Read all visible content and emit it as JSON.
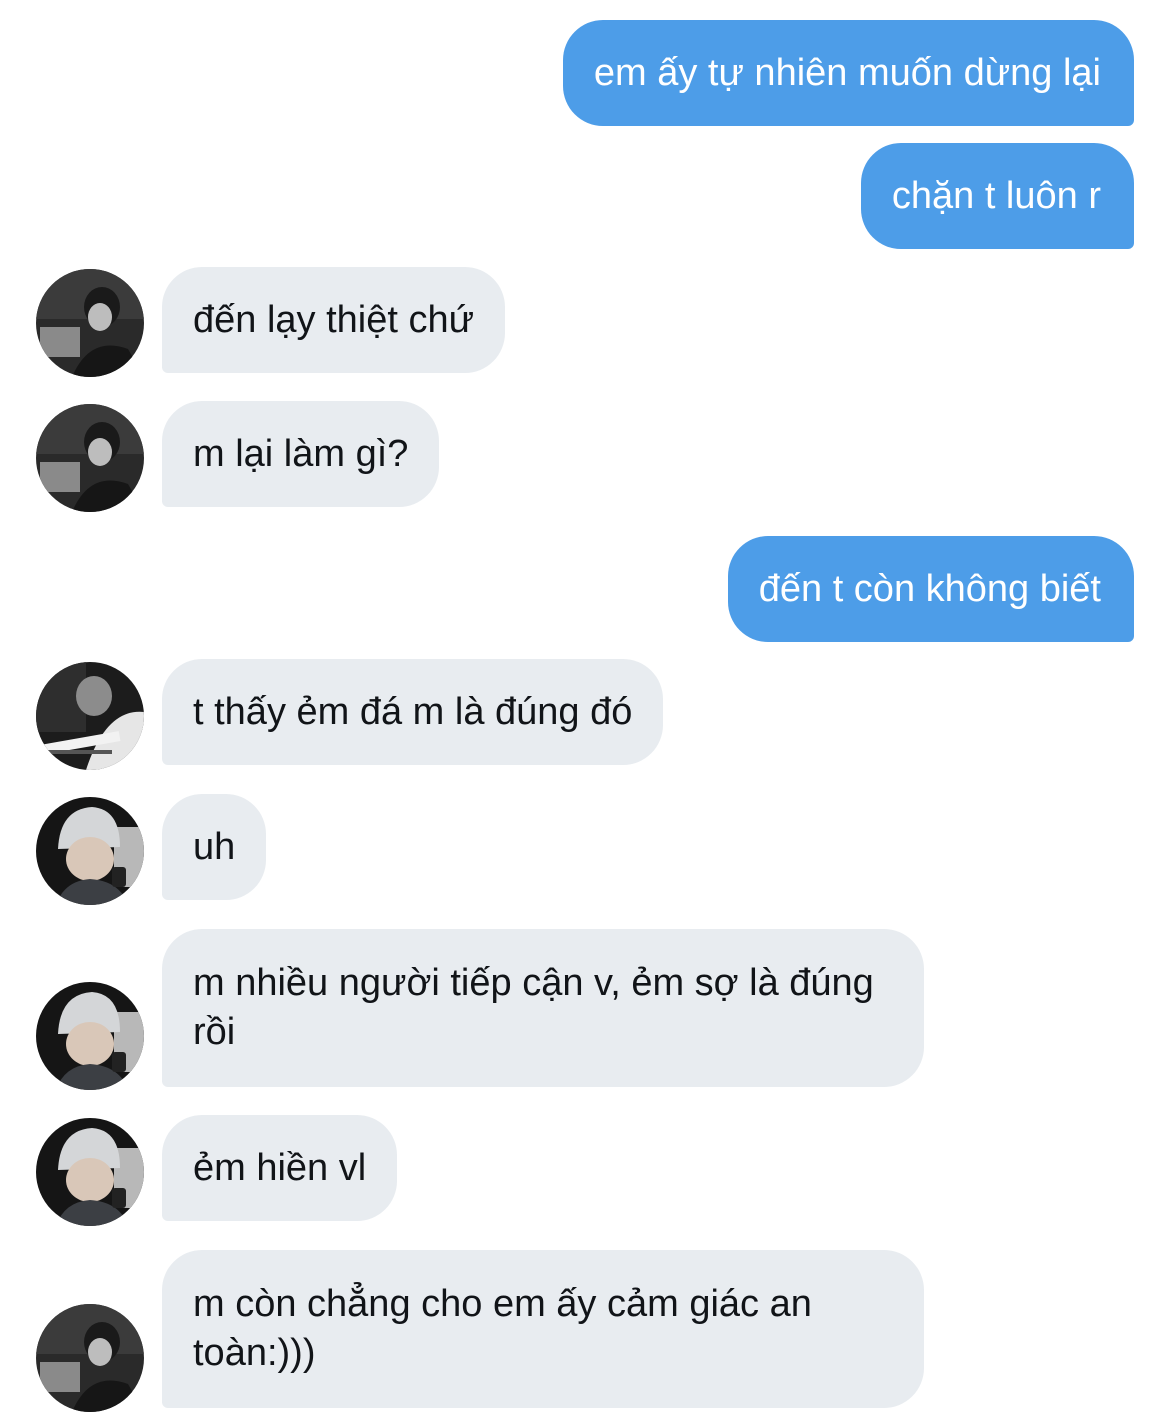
{
  "messages": [
    {
      "id": "m1",
      "side": "sent",
      "text": "em ấy tự nhiên muốn dừng lại"
    },
    {
      "id": "m2",
      "side": "sent",
      "text": "chặn t luôn r"
    },
    {
      "id": "m3",
      "side": "received",
      "avatar": "avatar-a",
      "text": "đến lạy thiệt chứ"
    },
    {
      "id": "m4",
      "side": "received",
      "avatar": "avatar-a",
      "text": "m lại làm gì?"
    },
    {
      "id": "m5",
      "side": "sent",
      "text": "đến t còn không biết"
    },
    {
      "id": "m6",
      "side": "received",
      "avatar": "avatar-b",
      "text": "t thấy ẻm đá m là đúng đó"
    },
    {
      "id": "m7",
      "side": "received",
      "avatar": "avatar-c",
      "text": "uh"
    },
    {
      "id": "m8",
      "side": "received",
      "avatar": "avatar-c",
      "text": "m nhiều người tiếp cận v, ẻm sợ là đúng rồi"
    },
    {
      "id": "m9",
      "side": "received",
      "avatar": "avatar-c",
      "text": "ẻm hiền vl"
    },
    {
      "id": "m10",
      "side": "received",
      "avatar": "avatar-a",
      "text": "m còn chẳng cho em ấy cảm giác an toàn:)))"
    }
  ],
  "colors": {
    "sent_bubble": "#4d9de8",
    "sent_text": "#ffffff",
    "received_bubble": "#e8ecf0",
    "received_text": "#111418"
  }
}
